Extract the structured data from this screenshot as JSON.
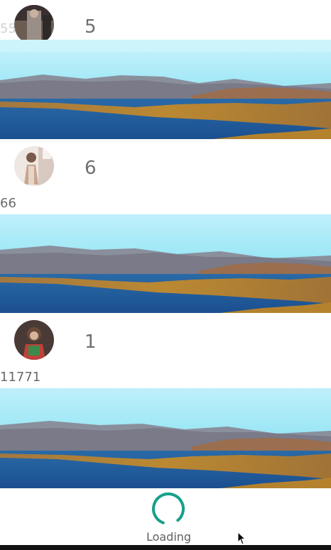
{
  "posts": [
    {
      "count": "5",
      "caption": "55",
      "avatar_icon": "person-photo-avatar"
    },
    {
      "count": "6",
      "caption": "66",
      "avatar_icon": "person-photo-avatar"
    },
    {
      "count": "1",
      "caption": "11771",
      "avatar_icon": "person-photo-avatar"
    }
  ],
  "footer": {
    "loading_label": "Loading",
    "spinner_color": "#17a08a"
  },
  "colors": {
    "sky": "#8fe3f3",
    "water": "#1f5fa8",
    "land": "#b8862f"
  }
}
